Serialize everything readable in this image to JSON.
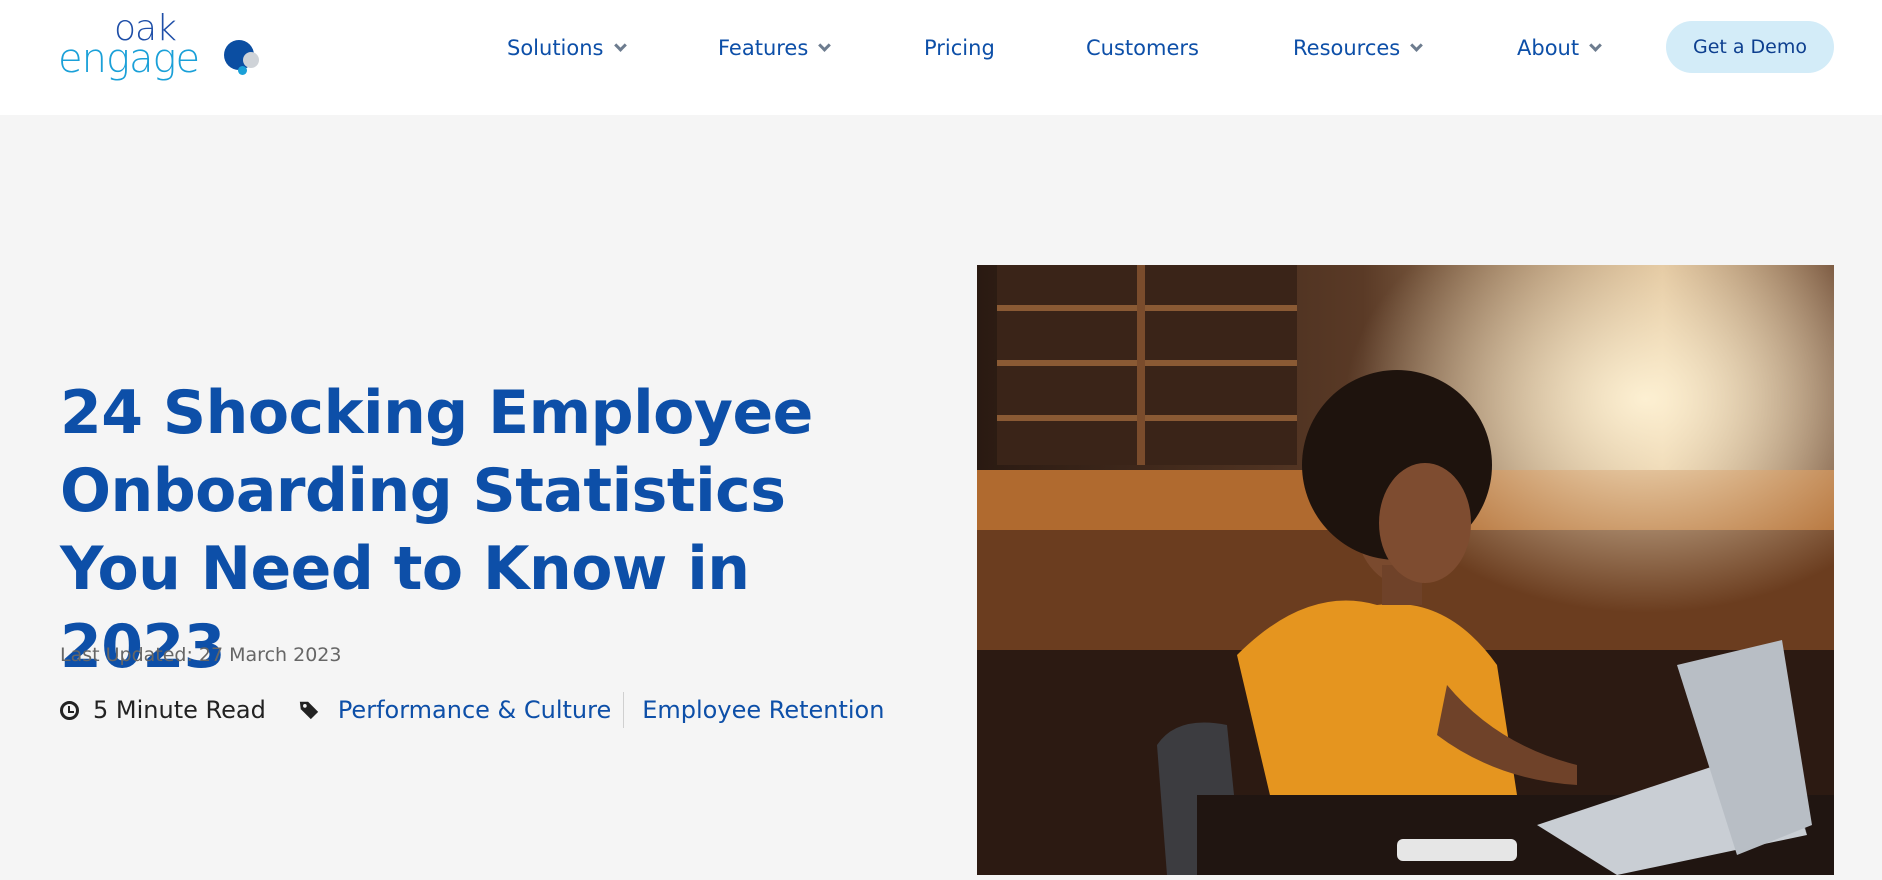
{
  "logo": {
    "line1": "oak",
    "line2": "engage"
  },
  "nav": {
    "items": [
      {
        "label": "Solutions",
        "has_dropdown": true
      },
      {
        "label": "Features",
        "has_dropdown": true
      },
      {
        "label": "Pricing",
        "has_dropdown": false
      },
      {
        "label": "Customers",
        "has_dropdown": false
      },
      {
        "label": "Resources",
        "has_dropdown": true
      },
      {
        "label": "About",
        "has_dropdown": true
      }
    ],
    "cta": "Get a Demo"
  },
  "article": {
    "title": "24 Shocking Employee Onboarding Statistics You Need to Know in 2023",
    "last_updated": "Last Updated: 27 March 2023",
    "read_time": "5 Minute Read",
    "tags": [
      "Performance & Culture",
      "Employee Retention"
    ]
  },
  "icons": {
    "clock": "clock-icon",
    "tag": "tag-icon",
    "chevron": "chevron-down-icon"
  },
  "colors": {
    "brand_blue": "#0d4fa8",
    "accent_cyan": "#1aa0d8",
    "cta_bg": "#d3ecf8",
    "page_bg": "#f5f5f5"
  }
}
